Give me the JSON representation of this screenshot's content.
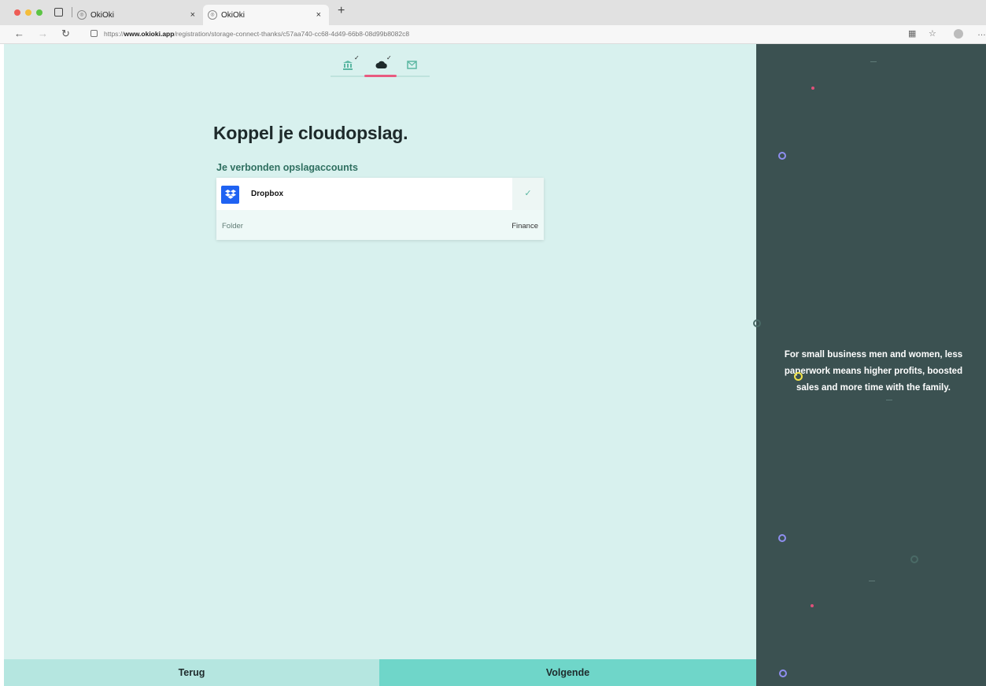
{
  "browser": {
    "tabs": [
      {
        "title": "OkiOki",
        "close": "×"
      },
      {
        "title": "OkiOki",
        "close": "×"
      }
    ],
    "new_tab": "+",
    "url_prefix": "https://",
    "url_domain": "www.okioki.app",
    "url_path": "/registration/storage-connect-thanks/c57aa740-cc68-4d49-66b8-08d99b8082c8"
  },
  "steps": {
    "items": [
      {
        "name": "bank",
        "icon": "bank-icon",
        "done": true
      },
      {
        "name": "cloud",
        "icon": "cloud-icon",
        "done": true,
        "active": true
      },
      {
        "name": "mail",
        "icon": "mail-icon",
        "done": false
      }
    ],
    "check": "✓"
  },
  "page": {
    "title": "Koppel je cloudopslag.",
    "section_label": "Je verbonden opslagaccounts"
  },
  "storage_card": {
    "provider": "Dropbox",
    "folder_label": "Folder",
    "folder_value": "Finance",
    "check": "✓"
  },
  "buttons": {
    "back": "Terug",
    "next": "Volgende"
  },
  "side_panel": {
    "quote": "For small business men and women, less paperwork means higher profits, boosted sales and more time with the family."
  },
  "colors": {
    "main_bg": "#d8f1ee",
    "side_bg": "#3b5151",
    "accent_pink": "#e85b7f",
    "button_back": "#b5e6e0",
    "button_next": "#6fd6c9",
    "dropbox_blue": "#1f62f2"
  }
}
